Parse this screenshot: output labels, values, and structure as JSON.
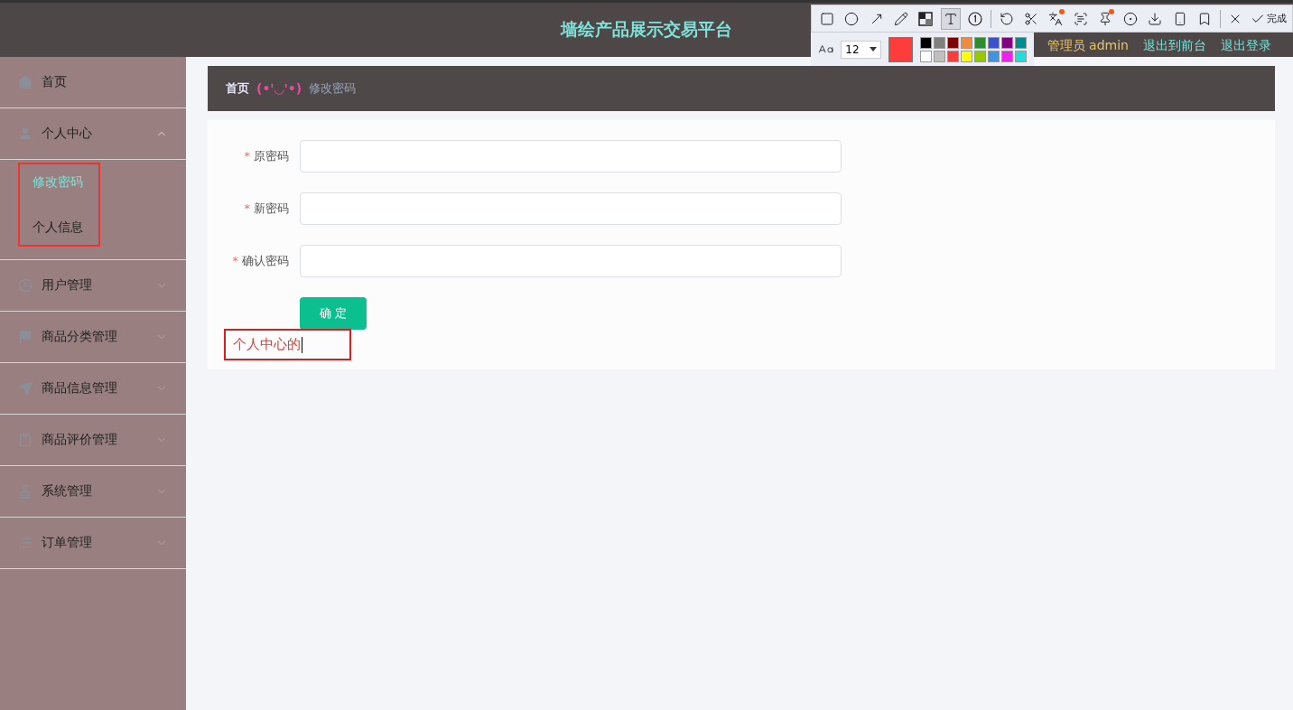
{
  "header": {
    "title": "墙绘产品展示交易平台",
    "user": "管理员 admin",
    "links": [
      "退出到前台",
      "退出登录"
    ]
  },
  "sidebar": {
    "items": [
      {
        "kind": "home",
        "label": "首页"
      },
      {
        "kind": "user",
        "label": "个人中心",
        "expanded": true,
        "children": [
          {
            "label": "修改密码",
            "selected": true
          },
          {
            "label": "个人信息",
            "selected": false
          }
        ]
      },
      {
        "kind": "clock",
        "label": "用户管理",
        "expanded": false
      },
      {
        "kind": "flag",
        "label": "商品分类管理",
        "expanded": false
      },
      {
        "kind": "send",
        "label": "商品信息管理",
        "expanded": false
      },
      {
        "kind": "clipboard",
        "label": "商品评价管理",
        "expanded": false
      },
      {
        "kind": "system",
        "label": "系统管理",
        "expanded": false
      },
      {
        "kind": "list",
        "label": "订单管理",
        "expanded": false
      }
    ]
  },
  "breadcrumb": {
    "home": "首页",
    "separator": "(•'◡'•)",
    "current": "修改密码"
  },
  "form": {
    "fields": [
      {
        "label": "原密码",
        "required_mark": "*"
      },
      {
        "label": "新密码",
        "required_mark": "*"
      },
      {
        "label": "确认密码",
        "required_mark": "*"
      }
    ],
    "button": "确 定"
  },
  "screenshot_tool": {
    "tools": [
      {
        "kind": "rect",
        "selected": false,
        "badge": false
      },
      {
        "kind": "circle",
        "selected": false,
        "badge": false
      },
      {
        "kind": "arrow",
        "selected": false,
        "badge": false
      },
      {
        "kind": "pencil",
        "selected": false,
        "badge": false
      },
      {
        "kind": "mosaic",
        "selected": false,
        "badge": false
      },
      {
        "kind": "text",
        "selected": true,
        "badge": false
      },
      {
        "kind": "number",
        "selected": false,
        "badge": false
      },
      {
        "kind": "undo",
        "selected": false,
        "badge": false
      },
      {
        "kind": "scissors",
        "selected": false,
        "badge": false
      },
      {
        "kind": "translate",
        "selected": false,
        "badge": true
      },
      {
        "kind": "ocr",
        "selected": false,
        "badge": false
      },
      {
        "kind": "pin",
        "selected": false,
        "badge": true
      },
      {
        "kind": "record",
        "selected": false,
        "badge": false
      },
      {
        "kind": "download",
        "selected": false,
        "badge": false
      },
      {
        "kind": "phone",
        "selected": false,
        "badge": false
      },
      {
        "kind": "bookmark",
        "selected": false,
        "badge": false
      },
      {
        "kind": "close",
        "selected": false,
        "badge": false
      }
    ],
    "done": "完成",
    "font_size": "12",
    "current_swatch": {
      "color": "#ff3b3b"
    },
    "palette": [
      {
        "color": "#000000"
      },
      {
        "color": "#808080"
      },
      {
        "color": "#800000"
      },
      {
        "color": "#f08c3c"
      },
      {
        "color": "#2e8b2e"
      },
      {
        "color": "#3c50d2"
      },
      {
        "color": "#800080"
      },
      {
        "color": "#008c8c"
      },
      {
        "color": "#ffffff"
      },
      {
        "color": "#c0c0c0"
      },
      {
        "color": "#ff3c3c"
      },
      {
        "color": "#ffff00"
      },
      {
        "color": "#96c800"
      },
      {
        "color": "#3c96e6"
      },
      {
        "color": "#f020f0"
      },
      {
        "color": "#20dcdc"
      }
    ]
  },
  "annotations": {
    "text": "个人中心的"
  }
}
